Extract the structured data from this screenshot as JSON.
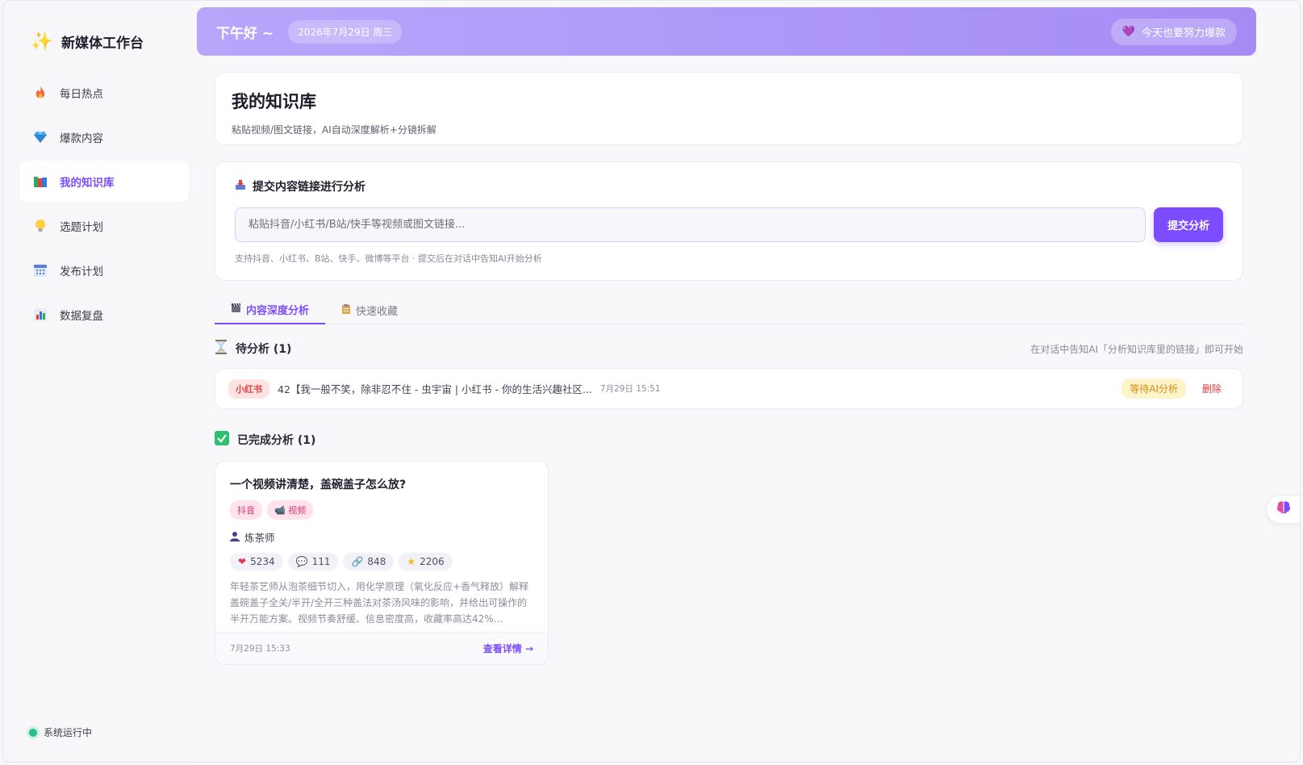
{
  "sidebar": {
    "brand": "新媒体工作台",
    "items": [
      {
        "label": "每日热点",
        "icon": "fire-icon",
        "active": false
      },
      {
        "label": "爆款内容",
        "icon": "diamond-icon",
        "active": false
      },
      {
        "label": "我的知识库",
        "icon": "books-icon",
        "active": true
      },
      {
        "label": "选题计划",
        "icon": "bulb-icon",
        "active": false
      },
      {
        "label": "发布计划",
        "icon": "calendar-icon",
        "active": false
      },
      {
        "label": "数据复盘",
        "icon": "bar-chart-icon",
        "active": false
      }
    ],
    "status": "系统运行中"
  },
  "header": {
    "greeting": "下午好 ~",
    "date": "2026年7月29日 周三",
    "motto": "今天也要努力爆款"
  },
  "knowledge": {
    "title": "我的知识库",
    "subtitle": "粘贴视频/图文链接，AI自动深度解析+分镜拆解"
  },
  "submit": {
    "heading": "提交内容链接进行分析",
    "placeholder": "粘贴抖音/小红书/B站/快手等视频或图文链接...",
    "button": "提交分析",
    "hint": "支持抖音、小红书、B站、快手、微博等平台 · 提交后在对话中告知AI开始分析"
  },
  "tabs": [
    {
      "label": "内容深度分析",
      "active": true
    },
    {
      "label": "快速收藏",
      "active": false
    }
  ],
  "pending": {
    "title": "待分析 (1)",
    "hint": "在对话中告知AI「分析知识库里的链接」即可开始",
    "item": {
      "platform": "小红书",
      "text": "42【我一般不笑，除非忍不住 - 虫宇宙 | 小红书 - 你的生活兴趣社区...",
      "time": "7月29日 15:51",
      "status": "等待AI分析",
      "delete": "删除"
    }
  },
  "completed": {
    "title": "已完成分析 (1)",
    "card": {
      "title": "一个视频讲清楚，盖碗盖子怎么放?",
      "tags": [
        "抖音",
        "视频"
      ],
      "author": "炼茶师",
      "stats": {
        "likes": "5234",
        "comments": "111",
        "shares": "848",
        "favorites": "2206"
      },
      "summary": "年轻茶艺师从泡茶细节切入，用化学原理（氧化反应+香气释放）解释盖碗盖子全关/半开/全开三种盖法对茶汤风味的影响，并给出可操作的半开万能方案。视频节奏舒缓、信息密度高，收藏率高达42%...",
      "time": "7月29日 15:33",
      "detail": "查看详情 →"
    }
  },
  "colors": {
    "accent": "#7c4dff",
    "status_green": "#21c38a",
    "danger": "#e33a3a"
  }
}
